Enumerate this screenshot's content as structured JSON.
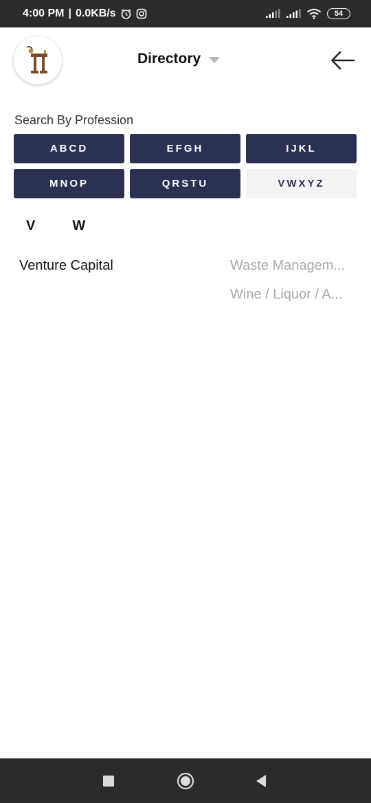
{
  "status_bar": {
    "time": "4:00 PM",
    "separator": "|",
    "speed": "0.0KB/s",
    "battery": "54"
  },
  "header": {
    "title": "Directory"
  },
  "search": {
    "label": "Search By Profession",
    "groups": [
      "ABCD",
      "EFGH",
      "IJKL",
      "MNOP",
      "QRSTU",
      "VWXYZ"
    ],
    "selected_group": "VWXYZ"
  },
  "letter_tabs": [
    "V",
    "W"
  ],
  "results": {
    "venture": "Venture Capital",
    "waste": "Waste Managem...",
    "wine": "Wine / Liquor / A..."
  },
  "colors": {
    "button_bg": "#2a3152",
    "button_text": "#ffffff",
    "active_bg": "#f4f4f6",
    "muted_text": "#a9a9a9",
    "system_bar": "#2b2b2b"
  }
}
